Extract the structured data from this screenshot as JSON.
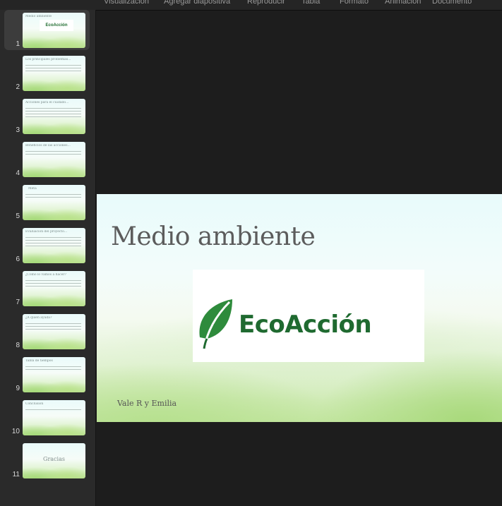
{
  "toolbar": {
    "items": [
      "Visualización",
      "Agregar diapositiva",
      "Reproducir",
      "Tabla",
      "Formato",
      "Animación",
      "Documento"
    ]
  },
  "sidebar": {
    "selected": 1,
    "slides": [
      {
        "number": "1",
        "title": "Medio ambiente",
        "logo": "EcoAcción"
      },
      {
        "number": "2",
        "title": "Los principales problemas..."
      },
      {
        "number": "3",
        "title": "Acciones para el cuidado..."
      },
      {
        "number": "4",
        "title": "Beneficios de las acciones..."
      },
      {
        "number": "5",
        "title": "Meta"
      },
      {
        "number": "6",
        "title": "Evaluación del proyecto..."
      },
      {
        "number": "7",
        "title": "¿Cómo lo vamos a hacer?"
      },
      {
        "number": "8",
        "title": "¿A quién ayuda?"
      },
      {
        "number": "9",
        "title": "Tabla de tiempos"
      },
      {
        "number": "10",
        "title": "Conclusión"
      },
      {
        "number": "11",
        "big_text": "Gracias"
      }
    ]
  },
  "slide": {
    "title": "Medio ambiente",
    "logo_text": "EcoAcción",
    "author": "Vale R y Emilia"
  },
  "colors": {
    "brand_green": "#1f6a30",
    "sidebar_bg": "#2a2a2a",
    "canvas_bg": "#1d1d1d"
  }
}
